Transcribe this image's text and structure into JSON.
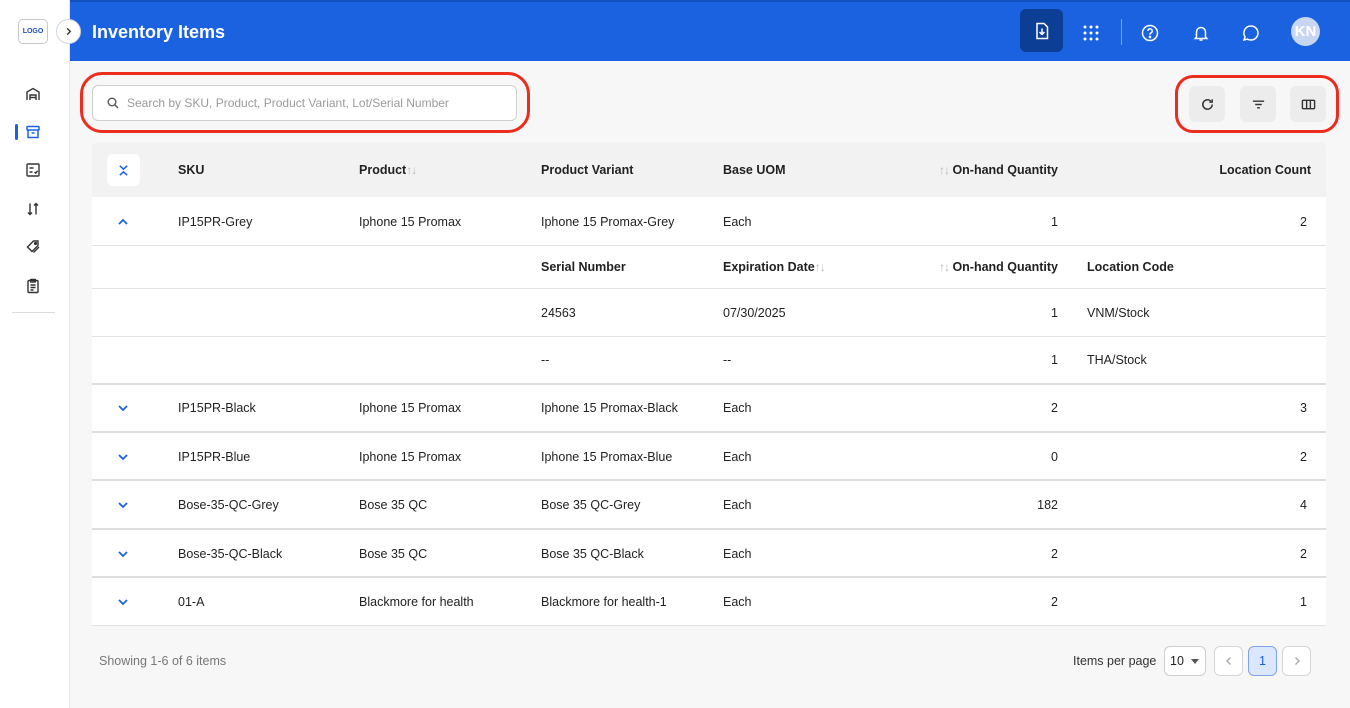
{
  "sidebar": {
    "logo_text": "LOGO",
    "items": [
      {
        "icon": "warehouse-icon",
        "active": false
      },
      {
        "icon": "inventory-box-icon",
        "active": true
      },
      {
        "icon": "checklist-icon",
        "active": false
      },
      {
        "icon": "sort-arrows-icon",
        "active": false
      },
      {
        "icon": "tags-icon",
        "active": false
      },
      {
        "icon": "clipboard-icon",
        "active": false
      }
    ]
  },
  "header": {
    "title": "Inventory Items",
    "avatar_initials": "KN",
    "accent_color": "#1a62e0"
  },
  "search": {
    "placeholder": "Search by SKU, Product, Product Variant, Lot/Serial Number",
    "value": ""
  },
  "table": {
    "columns": [
      "SKU",
      "Product",
      "Product Variant",
      "Base UOM",
      "On-hand Quantity",
      "Location Count"
    ],
    "sort_glyph": "↑↓",
    "rows": [
      {
        "sku": "IP15PR-Grey",
        "product": "Iphone 15 Promax",
        "variant": "Iphone 15 Promax-Grey",
        "uom": "Each",
        "qty": "1",
        "locations": "2",
        "expanded": true
      },
      {
        "sku": "IP15PR-Black",
        "product": "Iphone 15 Promax",
        "variant": "Iphone 15 Promax-Black",
        "uom": "Each",
        "qty": "2",
        "locations": "3",
        "expanded": false
      },
      {
        "sku": "IP15PR-Blue",
        "product": "Iphone 15 Promax",
        "variant": "Iphone 15 Promax-Blue",
        "uom": "Each",
        "qty": "0",
        "locations": "2",
        "expanded": false
      },
      {
        "sku": "Bose-35-QC-Grey",
        "product": "Bose 35 QC",
        "variant": "Bose 35 QC-Grey",
        "uom": "Each",
        "qty": "182",
        "locations": "4",
        "expanded": false
      },
      {
        "sku": "Bose-35-QC-Black",
        "product": "Bose 35 QC",
        "variant": "Bose 35 QC-Black",
        "uom": "Each",
        "qty": "2",
        "locations": "2",
        "expanded": false
      },
      {
        "sku": "01-A",
        "product": "Blackmore for health",
        "variant": "Blackmore for health-1",
        "uom": "Each",
        "qty": "2",
        "locations": "1",
        "expanded": false
      }
    ],
    "sub_columns": [
      "Serial Number",
      "Expiration Date",
      "On-hand Quantity",
      "Location Code"
    ],
    "sub_rows": [
      {
        "serial": "24563",
        "expiration": "07/30/2025",
        "qty": "1",
        "location": "VNM/Stock"
      },
      {
        "serial": "--",
        "expiration": "--",
        "qty": "1",
        "location": "THA/Stock"
      }
    ]
  },
  "footer": {
    "showing": "Showing 1-6 of 6 items",
    "items_per_page_label": "Items per page",
    "items_per_page": "10",
    "current_page": "1"
  }
}
